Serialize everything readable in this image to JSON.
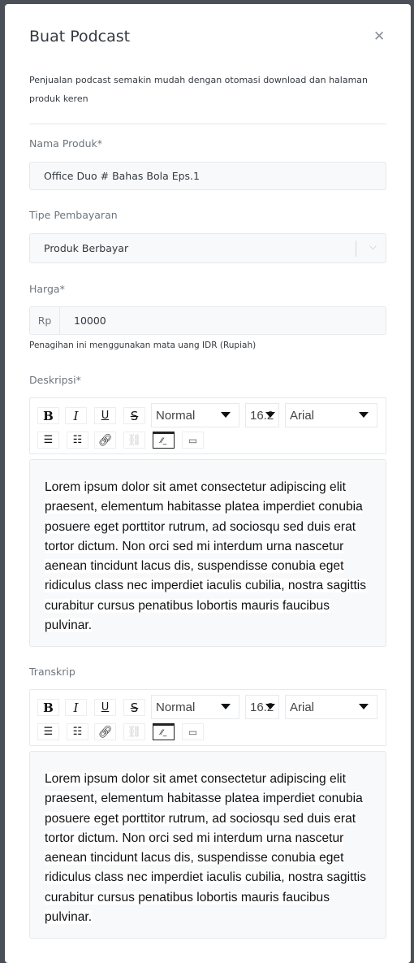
{
  "modal": {
    "title": "Buat Podcast",
    "close_icon": "close-icon",
    "description": "Penjualan podcast semakin mudah dengan otomasi download dan halaman produk keren"
  },
  "form": {
    "name": {
      "label": "Nama Produk*",
      "value": "Office Duo # Bahas Bola Eps.1"
    },
    "payment_type": {
      "label": "Tipe Pembayaran",
      "value": "Produk Berbayar"
    },
    "price": {
      "label": "Harga*",
      "prefix": "Rp",
      "value": "10000",
      "help": "Penagihan ini menggunakan mata uang IDR (Rupiah)"
    },
    "description": {
      "label": "Deskripsi*",
      "toolbar": {
        "bold": "B",
        "italic": "I",
        "underline": "U",
        "strike": "S",
        "heading": "Normal",
        "size": "16.2",
        "font": "Arial"
      },
      "text": "Lorem ipsum dolor sit amet consectetur adipiscing elit praesent, elementum habitasse platea imperdiet conubia posuere eget porttitor rutrum, ad sociosqu sed duis erat tortor dictum. Non orci sed mi interdum urna nascetur aenean tincidunt lacus dis, suspendisse conubia eget ridiculus class nec imperdiet iaculis cubilia, nostra sagittis curabitur cursus penatibus lobortis mauris faucibus pulvinar."
    },
    "transcript": {
      "label": "Transkrip",
      "toolbar": {
        "bold": "B",
        "italic": "I",
        "underline": "U",
        "strike": "S",
        "heading": "Normal",
        "size": "16.2",
        "font": "Arial"
      },
      "text": "Lorem ipsum dolor sit amet consectetur adipiscing elit praesent, elementum habitasse platea imperdiet conubia posuere eget porttitor rutrum, ad sociosqu sed duis erat tortor dictum. Non orci sed mi interdum urna nascetur aenean tincidunt lacus dis, suspendisse conubia eget ridiculus class nec imperdiet iaculis cubilia, nostra sagittis curabitur cursus penatibus lobortis mauris faucibus pulvinar."
    }
  }
}
